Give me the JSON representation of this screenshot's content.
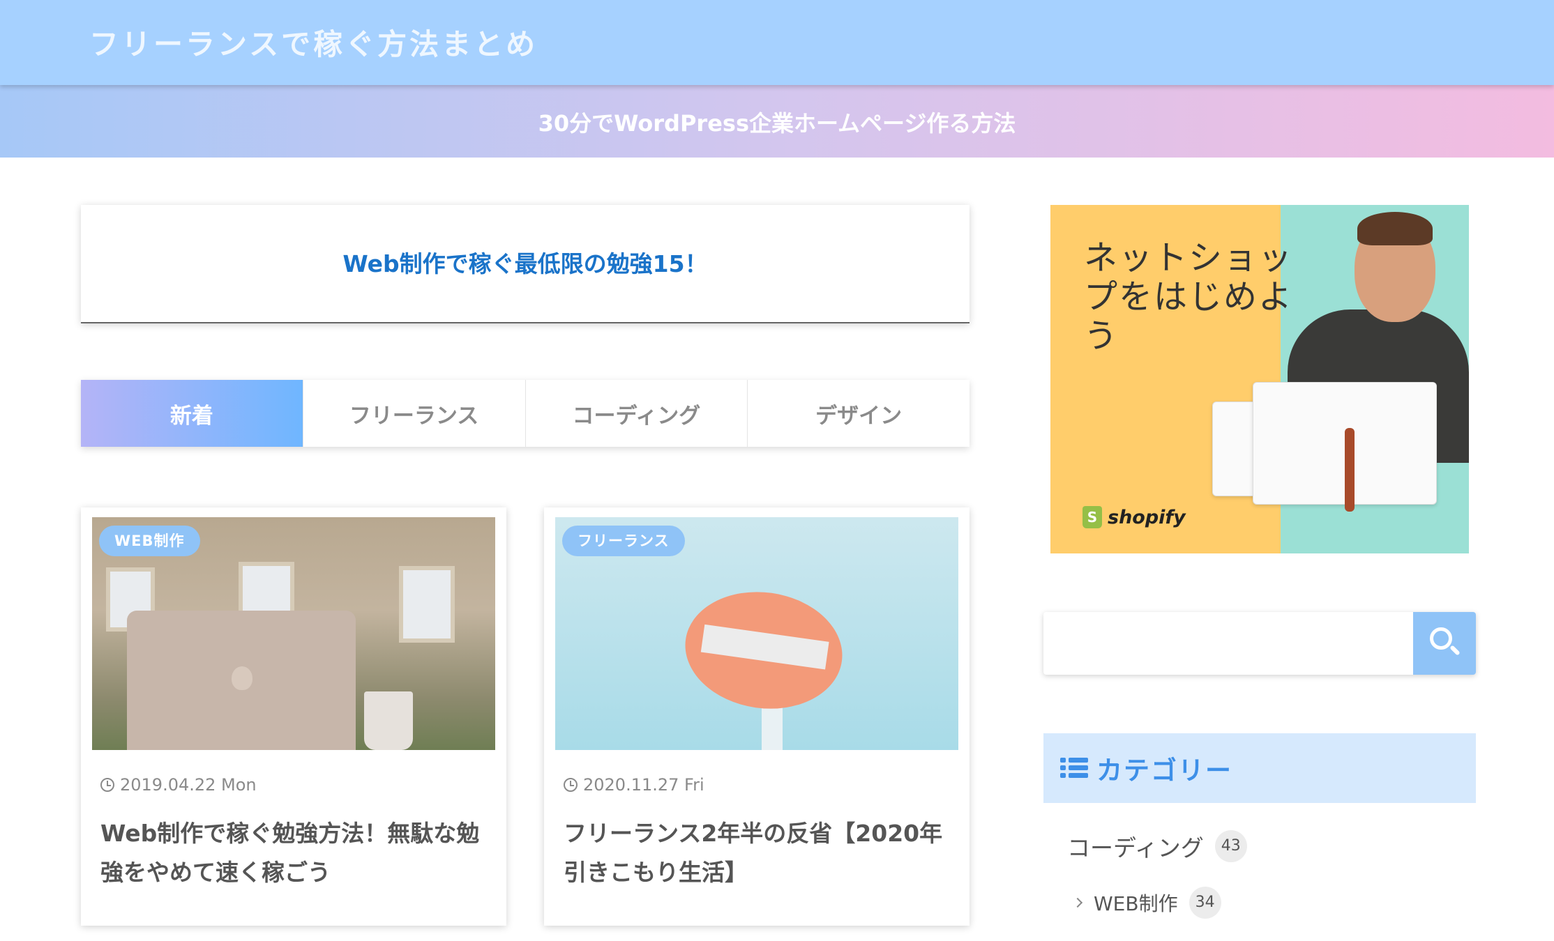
{
  "header": {
    "site_title": "フリーランスで稼ぐ方法まとめ"
  },
  "notice": {
    "text": "30分でWordPress企業ホームページ作る方法"
  },
  "feature": {
    "link_text": "Web制作で稼ぐ最低限の勉強15！"
  },
  "tabs": [
    {
      "label": "新着",
      "active": true
    },
    {
      "label": "フリーランス",
      "active": false
    },
    {
      "label": "コーディング",
      "active": false
    },
    {
      "label": "デザイン",
      "active": false
    }
  ],
  "posts": [
    {
      "category": "WEB制作",
      "date": "2019.04.22 Mon",
      "title": "Web制作で稼ぐ勉強方法！無駄な勉強をやめて速く稼ごう"
    },
    {
      "category": "フリーランス",
      "date": "2020.11.27 Fri",
      "title": "フリーランス2年半の反省【2020年引きこもり生活】"
    }
  ],
  "sidebar": {
    "ad": {
      "text": "ネットショップをはじめよう",
      "brand": "shopify"
    },
    "search": {
      "placeholder": "",
      "icon": "search-icon"
    },
    "categories": {
      "title": "カテゴリー",
      "icon": "list-icon",
      "items": [
        {
          "label": "コーディング",
          "count": "43"
        },
        {
          "label": "WEB制作",
          "count": "34"
        }
      ]
    }
  },
  "colors": {
    "header_bg": "#a6d1ff",
    "accent": "#3d8fe8",
    "link": "#1a73c9",
    "badge": "#8fc3f7"
  }
}
